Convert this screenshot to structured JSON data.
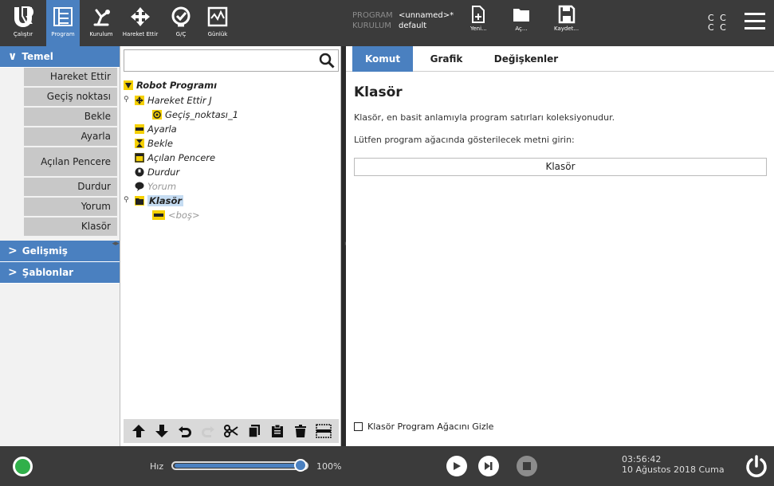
{
  "topbar": {
    "nav": [
      {
        "label": "Çalıştır",
        "icon": "ur-logo-icon"
      },
      {
        "label": "Program",
        "icon": "program-tree-icon"
      },
      {
        "label": "Kurulum",
        "icon": "robot-arm-icon"
      },
      {
        "label": "Hareket Ettir",
        "icon": "move-arrows-icon"
      },
      {
        "label": "G/Ç",
        "icon": "io-icon"
      },
      {
        "label": "Günlük",
        "icon": "log-icon"
      }
    ],
    "program_key": "PROGRAM",
    "program_value": "<unnamed>*",
    "install_key": "KURULUM",
    "install_value": "default",
    "new_label": "Yeni...",
    "open_label": "Aç...",
    "save_label": "Kaydet...",
    "cc_line1": "C C",
    "cc_line2": "C C"
  },
  "left": {
    "basic_header": "Temel",
    "commands": [
      "Hareket Ettir",
      "Geçiş noktası",
      "Bekle",
      "Ayarla",
      "Açılan Pencere",
      "Durdur",
      "Yorum",
      "Klasör"
    ],
    "advanced_header": "Gelişmiş",
    "templates_header": "Şablonlar"
  },
  "tree": {
    "search_value": "",
    "rows": [
      {
        "text": "Robot Programı",
        "icon": "collapse-triangle-icon"
      },
      {
        "text": "Hareket Ettir J",
        "icon": "move-icon"
      },
      {
        "text": "Geçiş_noktası_1",
        "icon": "waypoint-icon"
      },
      {
        "text": "Ayarla",
        "icon": "set-icon"
      },
      {
        "text": "Bekle",
        "icon": "hourglass-icon"
      },
      {
        "text": "Açılan Pencere",
        "icon": "popup-icon"
      },
      {
        "text": "Durdur",
        "icon": "halt-icon"
      },
      {
        "text": "Yorum",
        "icon": "comment-icon"
      },
      {
        "text": "Klasör",
        "icon": "folder-icon"
      },
      {
        "text": "<boş>",
        "icon": "empty-icon"
      }
    ]
  },
  "right": {
    "tabs": [
      "Komut",
      "Grafik",
      "Değişkenler"
    ],
    "title": "Klasör",
    "description": "Klasör, en basit anlamıyla program satırları koleksiyonudur.",
    "prompt": "Lütfen program ağacında gösterilecek metni girin:",
    "input_value": "Klasör",
    "hide_checkbox_label": "Klasör Program Ağacını Gizle"
  },
  "bottom": {
    "speed_label": "Hız",
    "speed_value": "100%",
    "speed_fraction": 1.0,
    "time": "03:56:42",
    "date": "10 Ağustos 2018 Cuma"
  },
  "colors": {
    "accent": "#4a80c0",
    "bar": "#3b3b3b",
    "status_ok": "#30b04a",
    "selection": "#c5dcf2"
  }
}
